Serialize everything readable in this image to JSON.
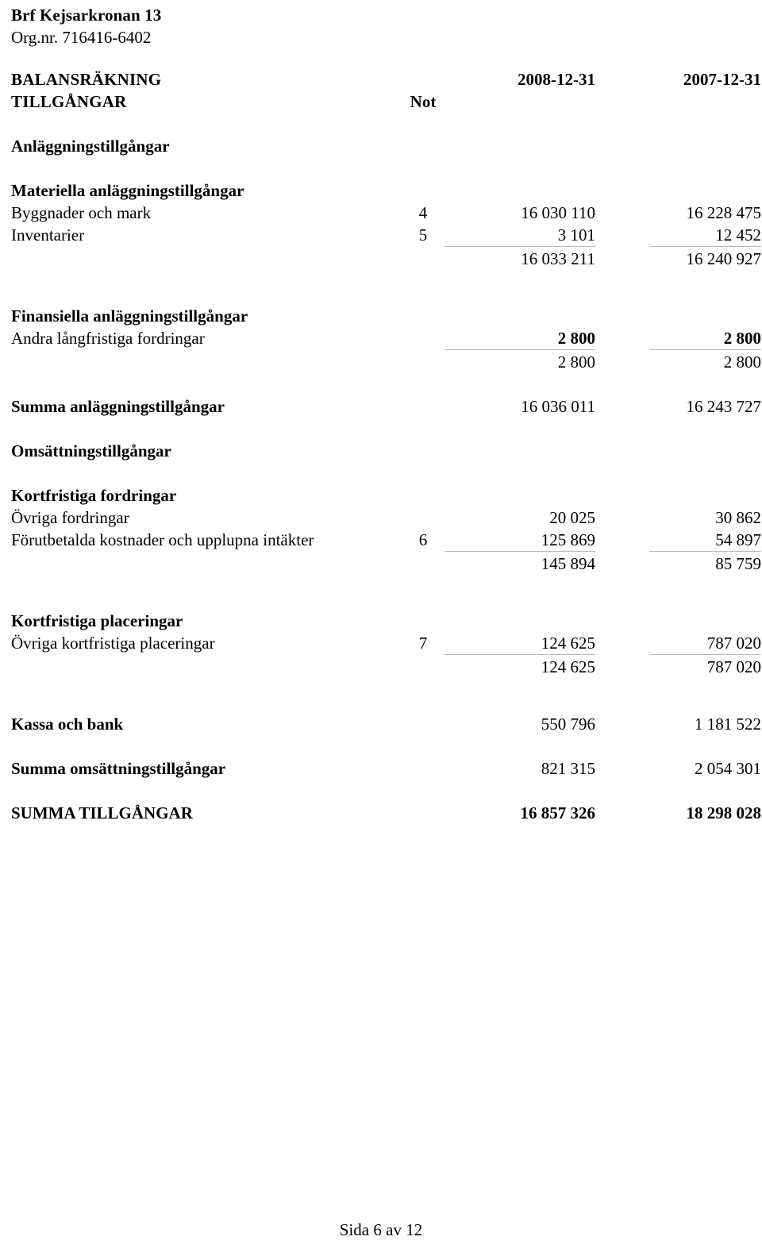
{
  "document": {
    "company_name": "Brf Kejsarkronan 13",
    "org_nr": "Org.nr. 716416-6402",
    "statement_title": "BALANSRÄKNING",
    "section_title": "TILLGÅNGAR",
    "footer": "Sida 6 av 12"
  },
  "columns": {
    "note_header": "Not",
    "period_current": "2008-12-31",
    "period_previous": "2007-12-31"
  },
  "rows": {
    "anlaggningstillgangar_heading": "Anläggningstillgångar",
    "materiella_heading": "Materiella anläggningstillgångar",
    "byggnader": {
      "label": "Byggnader och mark",
      "note": "4",
      "v1": "16 030 110",
      "v2": "16 228 475"
    },
    "inventarier": {
      "label": "Inventarier",
      "note": "5",
      "v1": "3 101",
      "v2": "12 452"
    },
    "materiella_total": {
      "label": "",
      "note": "",
      "v1": "16 033 211",
      "v2": "16 240 927"
    },
    "finansiella_heading": "Finansiella anläggningstillgångar",
    "andra_langfristiga": {
      "label": "Andra långfristiga fordringar",
      "note": "",
      "v1": "2 800",
      "v2": "2 800"
    },
    "finansiella_total": {
      "label": "",
      "note": "",
      "v1": "2 800",
      "v2": "2 800"
    },
    "summa_anlaggning": {
      "label": "Summa anläggningstillgångar",
      "note": "",
      "v1": "16 036 011",
      "v2": "16 243 727"
    },
    "omsattningstillgangar_heading": "Omsättningstillgångar",
    "kortfristiga_fordringar_heading": "Kortfristiga fordringar",
    "ovriga_fordringar": {
      "label": "Övriga fordringar",
      "note": "",
      "v1": "20 025",
      "v2": "30 862"
    },
    "forutbetalda": {
      "label": "Förutbetalda kostnader och upplupna intäkter",
      "note": "6",
      "v1": "125 869",
      "v2": "54 897"
    },
    "kortfristiga_fordringar_total": {
      "label": "",
      "note": "",
      "v1": "145 894",
      "v2": "85 759"
    },
    "kortfristiga_placeringar_heading": "Kortfristiga placeringar",
    "ovriga_kortfristiga_placeringar": {
      "label": "Övriga kortfristiga placeringar",
      "note": "7",
      "v1": "124 625",
      "v2": "787 020"
    },
    "kortfristiga_placeringar_total": {
      "label": "",
      "note": "",
      "v1": "124 625",
      "v2": "787 020"
    },
    "kassa_och_bank": {
      "label": "Kassa och bank",
      "note": "",
      "v1": "550 796",
      "v2": "1 181 522"
    },
    "summa_omsattning": {
      "label": "Summa omsättningstillgångar",
      "note": "",
      "v1": "821 315",
      "v2": "2 054 301"
    },
    "summa_tillgangar": {
      "label": "SUMMA TILLGÅNGAR",
      "note": "",
      "v1": "16 857 326",
      "v2": "18 298 028"
    }
  }
}
